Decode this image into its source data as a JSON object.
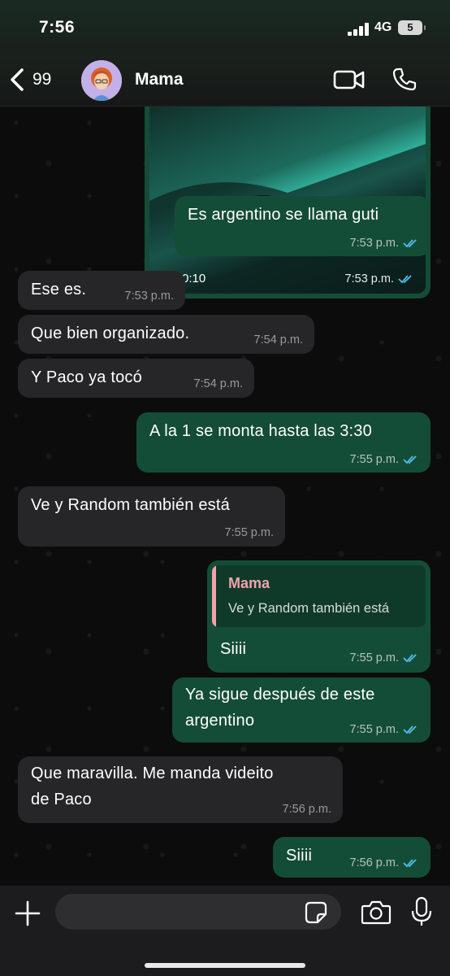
{
  "status_bar": {
    "time": "7:56",
    "network": "4G",
    "battery": "5"
  },
  "header": {
    "back_count": "99",
    "contact_name": "Mama"
  },
  "video_message": {
    "duration": "0:10",
    "time": "7:53 p.m."
  },
  "messages": [
    {
      "dir": "out",
      "text": "Es argentino se llama guti",
      "time": "7:53 p.m."
    },
    {
      "dir": "in",
      "text": "Ese es.",
      "time": "7:53 p.m."
    },
    {
      "dir": "in",
      "text": "Que bien organizado.",
      "time": "7:54 p.m."
    },
    {
      "dir": "in",
      "text": "Y Paco ya tocó",
      "time": "7:54 p.m."
    },
    {
      "dir": "out",
      "text": "A la 1 se monta hasta las 3:30",
      "time": "7:55 p.m."
    },
    {
      "dir": "in",
      "text": "Ve y Random también está",
      "time": "7:55 p.m."
    },
    {
      "dir": "out",
      "quote_name": "Mama",
      "quote_text": "Ve y Random también está",
      "text": "Siiii",
      "time": "7:55 p.m."
    },
    {
      "dir": "out",
      "line1": "Ya sigue después de este",
      "line2": "argentino",
      "time": "7:55 p.m."
    },
    {
      "dir": "in",
      "line1": "Que maravilla. Me manda videito",
      "line2": "de Paco",
      "time": "7:56 p.m."
    },
    {
      "dir": "out",
      "text": "Siiii",
      "time": "7:56 p.m."
    }
  ],
  "composer": {
    "placeholder": ""
  },
  "icons": {
    "back": "chevron-left-icon",
    "video_call": "video-camera-icon",
    "voice_call": "phone-icon",
    "attach": "plus-icon",
    "sticker": "sticker-icon",
    "camera": "camera-icon",
    "mic": "microphone-icon",
    "read_receipt": "double-check-icon"
  },
  "colors": {
    "outgoing_bubble": "#144d37",
    "incoming_bubble": "#262628",
    "read_tick": "#53bdeb",
    "quote_accent": "#f0a3ad"
  }
}
